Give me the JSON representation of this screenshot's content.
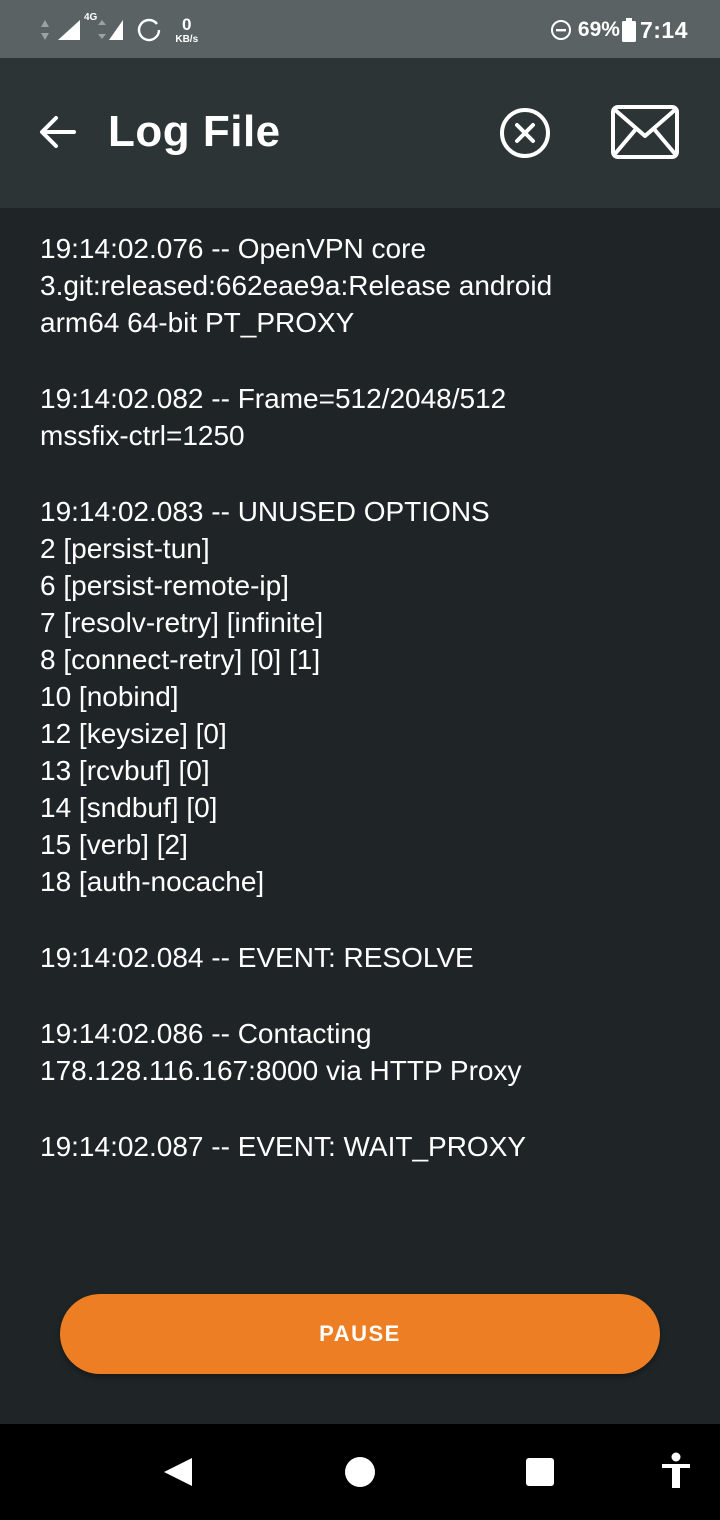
{
  "status_bar": {
    "network": "4G",
    "speed_value": "0",
    "speed_unit": "KB/s",
    "battery": "69%",
    "time": "7:14"
  },
  "toolbar": {
    "title": "Log File"
  },
  "log": {
    "entries": [
      "19:14:02.076 -- OpenVPN core\n3.git:released:662eae9a:Release android\narm64 64-bit PT_PROXY",
      "19:14:02.082 -- Frame=512/2048/512\nmssfix-ctrl=1250",
      "19:14:02.083 -- UNUSED OPTIONS\n2 [persist-tun]\n6 [persist-remote-ip]\n7 [resolv-retry] [infinite]\n8 [connect-retry] [0] [1]\n10 [nobind]\n12 [keysize] [0]\n13 [rcvbuf] [0]\n14 [sndbuf] [0]\n15 [verb] [2]\n18 [auth-nocache]",
      "19:14:02.084 -- EVENT: RESOLVE",
      "19:14:02.086 -- Contacting\n178.128.116.167:8000 via HTTP Proxy",
      "19:14:02.087 -- EVENT: WAIT_PROXY"
    ]
  },
  "actions": {
    "pause_label": "PAUSE"
  },
  "icons": {
    "back": "arrow-back-icon",
    "clear": "close-circle-icon",
    "mail": "mail-icon"
  },
  "colors": {
    "accent": "#ee7e23",
    "toolbar": "#2c3435",
    "background": "#1f2526",
    "status_bar": "#5a6263"
  }
}
